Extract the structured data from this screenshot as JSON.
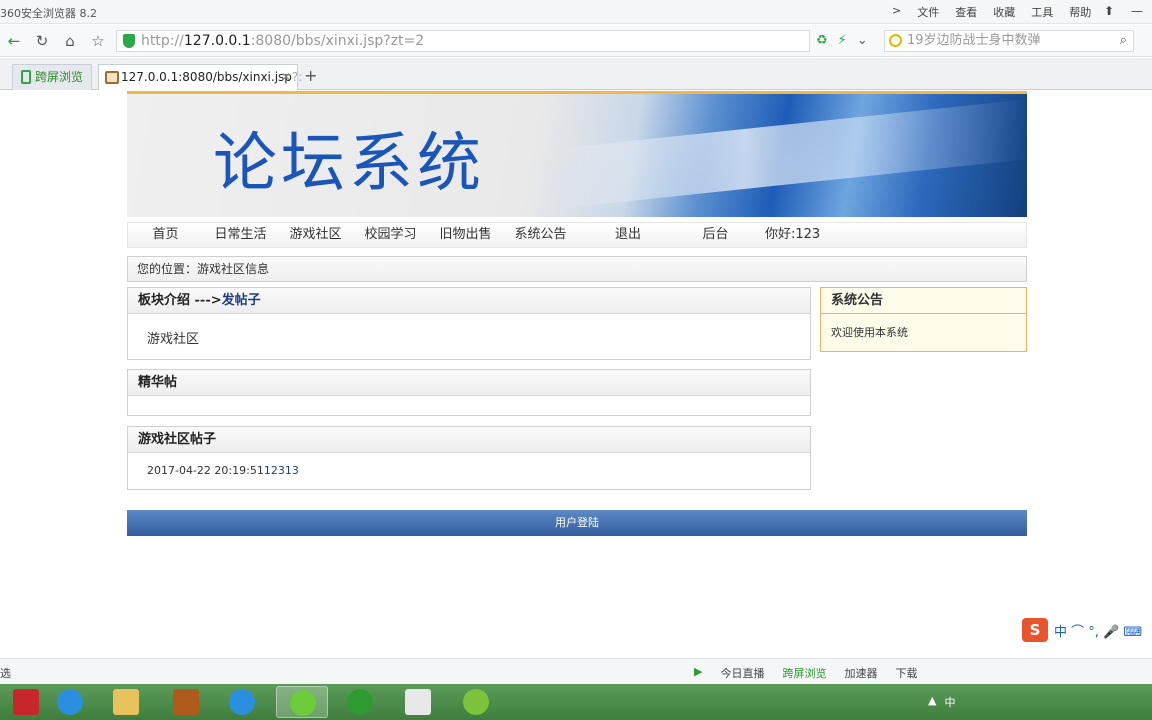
{
  "browser": {
    "title": "360安全浏览器 8.2",
    "menus": [
      "文件",
      "查看",
      "收藏",
      "工具",
      "帮助"
    ],
    "menu_arrow": ">",
    "window_buttons": [
      "⬆",
      "—",
      "□",
      "✕"
    ],
    "url_scheme": "http://",
    "url_host": "127.0.0.1",
    "url_rest": ":8080/bbs/xinxi.jsp?zt=2",
    "search_placeholder": "19岁边防战士身中数弹",
    "tabs": [
      {
        "label": "跨屏浏览"
      },
      {
        "label": "127.0.0.1:8080/bbs/xinxi.jsp",
        "suffix": "?:",
        "close": "✕"
      }
    ],
    "new_tab": "+"
  },
  "site": {
    "logo_text": "论坛系统",
    "nav": [
      "首页",
      "日常生活",
      "游戏社区",
      "校园学习",
      "旧物出售",
      "系统公告",
      "退出",
      "后台"
    ],
    "greeting": "你好:123",
    "breadcrumb": "您的位置：游戏社区信息",
    "section_intro": {
      "title": "板块介绍 --->",
      "link": "发帖子",
      "body": "游戏社区"
    },
    "featured": {
      "title": "精华帖"
    },
    "posts": {
      "title": "游戏社区帖子",
      "items": [
        {
          "date": "2017-04-22 20:19:51",
          "title": "12313"
        }
      ]
    },
    "notice": {
      "title": "系统公告",
      "body": "欢迎使用本系统"
    },
    "footer": "用户登陆"
  },
  "status": {
    "left": "选",
    "items": [
      "今日直播",
      "跨屏浏览",
      "加速器",
      "下载"
    ]
  },
  "ime": {
    "logo": "S",
    "text": "中 ⌒ °, 🎤 ⌨"
  },
  "taskbar": {
    "tray": [
      "▲",
      "中"
    ]
  },
  "colors": {
    "accent": "#345d9e",
    "link": "#1c3f80",
    "banner_text": "#1a56b8"
  }
}
